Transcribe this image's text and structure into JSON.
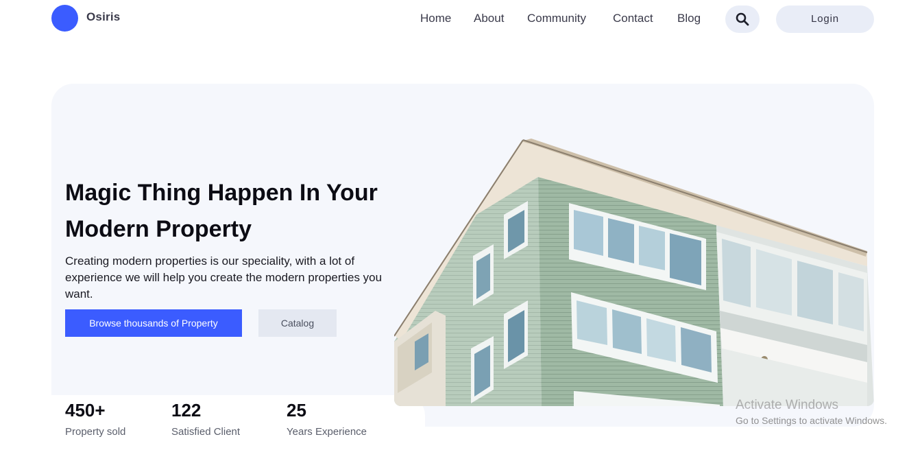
{
  "brand": {
    "name": "Osiris",
    "accent_color": "#3b5cff"
  },
  "nav": {
    "items": [
      "Home",
      "About",
      "Community",
      "Contact",
      "Blog"
    ],
    "search_icon": "search-icon",
    "login_label": "Login"
  },
  "hero": {
    "title": "Magic Thing Happen In Your Modern Property",
    "description": "Creating modern properties is our speciality, with a lot of experience we will help you create the modern properties you want.",
    "primary_button": "Browse thousands of Property",
    "secondary_button": "Catalog"
  },
  "stats": [
    {
      "value": "450+",
      "label": "Property sold"
    },
    {
      "value": "122",
      "label": "Satisfied Client"
    },
    {
      "value": "25",
      "label": "Years Experience"
    }
  ],
  "watermark": {
    "title": "Activate Windows",
    "subtitle": "Go to Settings to activate Windows."
  }
}
